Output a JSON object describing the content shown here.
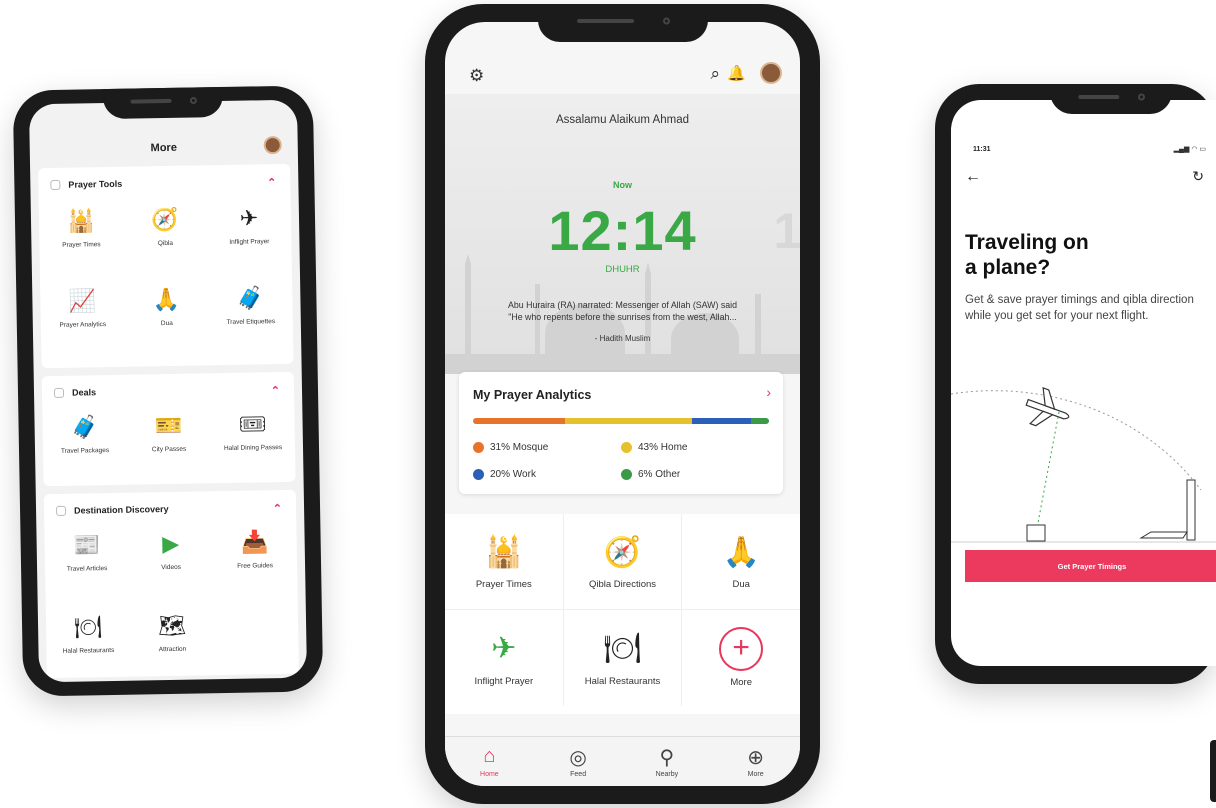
{
  "left_phone": {
    "title": "More",
    "sections": [
      {
        "title": "Prayer Tools",
        "items": [
          "Prayer Times",
          "Qibla",
          "Inflight Prayer",
          "Prayer Analytics",
          "Dua",
          "Travel Etiquettes"
        ]
      },
      {
        "title": "Deals",
        "items": [
          "Travel Packages",
          "City Passes",
          "Halal Dining Passes"
        ]
      },
      {
        "title": "Destination Discovery",
        "items": [
          "Travel Articles",
          "Videos",
          "Free Guides",
          "Halal Restaurants",
          "Attraction"
        ]
      }
    ]
  },
  "middle_phone": {
    "greeting": "Assalamu Alaikum",
    "user_name": "Ahmad",
    "now_label": "Now",
    "time": "12:14",
    "next_time_partial": "1!",
    "prayer_name": "DHUHR",
    "hadith_line1": "Abu Huraira (RA) narrated: Messenger of Allah (SAW) said",
    "hadith_line2": "\"He who repents before the sunrises from the west, Allah...",
    "hadith_source": "- Hadith Muslim",
    "analytics": {
      "title": "My Prayer Analytics",
      "arrow": "›",
      "segments": [
        {
          "label": "31% Mosque",
          "percent": 31,
          "color": "#e8742b"
        },
        {
          "label": "43% Home",
          "percent": 43,
          "color": "#e6c12e"
        },
        {
          "label": "20% Work",
          "percent": 20,
          "color": "#2b5fb8"
        },
        {
          "label": "6% Other",
          "percent": 6,
          "color": "#3a9a48"
        }
      ]
    },
    "tiles": [
      {
        "label": "Prayer Times",
        "icon": "mosque-icon"
      },
      {
        "label": "Qibla Directions",
        "icon": "qibla-icon"
      },
      {
        "label": "Dua",
        "icon": "dua-icon"
      },
      {
        "label": "Inflight Prayer",
        "icon": "plane-icon"
      },
      {
        "label": "Halal Restaurants",
        "icon": "cloche-icon"
      },
      {
        "label": "More",
        "icon": "plus-icon"
      }
    ],
    "tabs": [
      {
        "label": "Home",
        "icon": "home-icon"
      },
      {
        "label": "Feed",
        "icon": "camera-icon"
      },
      {
        "label": "Nearby",
        "icon": "pin-icon"
      },
      {
        "label": "More",
        "icon": "plus-circle-icon"
      }
    ]
  },
  "right_phone": {
    "status_time": "11:31",
    "heading_line1": "Traveling on",
    "heading_line2": "a plane?",
    "subtitle": "Get & save prayer timings and qibla direction while you get set for your next flight.",
    "cta": "Get Prayer Timings"
  },
  "colors": {
    "accent": "#e8365d",
    "green": "#39a845"
  }
}
